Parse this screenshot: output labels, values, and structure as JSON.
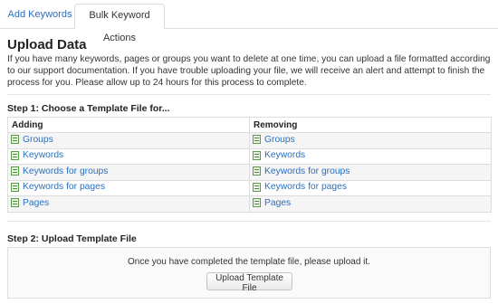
{
  "tabs": [
    {
      "label": "Add Keywords"
    },
    {
      "label": "Bulk Keyword Actions"
    }
  ],
  "page": {
    "title": "Upload Data",
    "description": "If you have many keywords, pages or groups you want to delete at one time, you can upload a file formatted according to our support documentation. If you have trouble uploading your file, we will receive an alert and attempt to finish the process for you. Please allow up to 24 hours for this process to complete."
  },
  "step1": {
    "title": "Step 1: Choose a Template File for...",
    "columns": [
      "Adding",
      "Removing"
    ],
    "rows": [
      {
        "adding": "Groups",
        "removing": "Groups"
      },
      {
        "adding": "Keywords",
        "removing": "Keywords"
      },
      {
        "adding": "Keywords for groups",
        "removing": "Keywords for groups"
      },
      {
        "adding": "Keywords for pages",
        "removing": "Keywords for pages"
      },
      {
        "adding": "Pages",
        "removing": "Pages"
      }
    ],
    "icon": "spreadsheet-file-icon"
  },
  "step2": {
    "title": "Step 2: Upload Template File",
    "instruction": "Once you have completed the template file, please upload it.",
    "button_label": "Upload Template File"
  }
}
